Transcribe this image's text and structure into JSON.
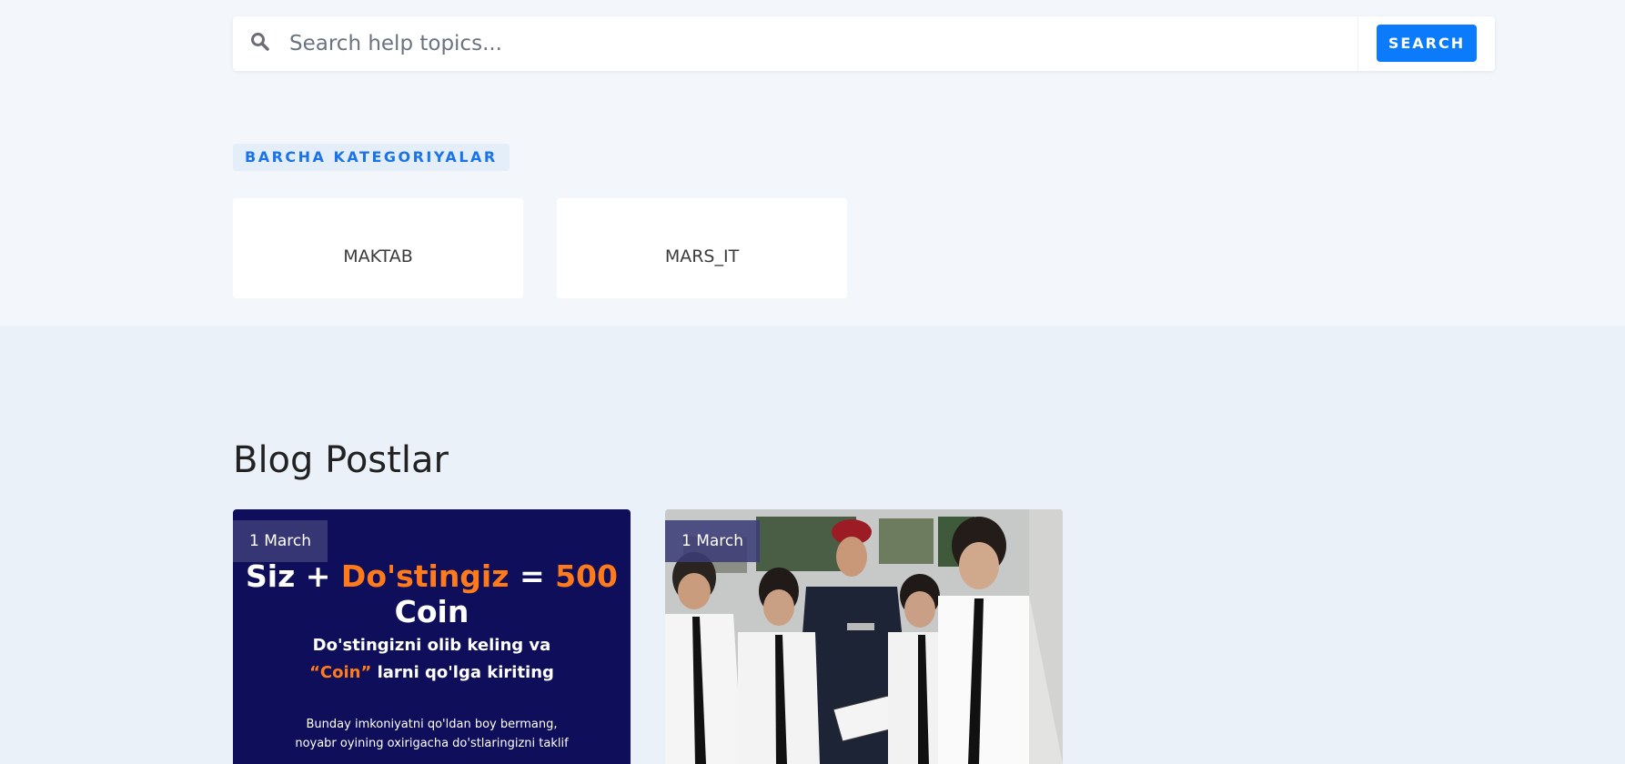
{
  "search": {
    "placeholder": "Search help topics...",
    "button_label": "SEARCH",
    "icon": "search-icon"
  },
  "categories": {
    "heading": "BARCHA KATEGORIYALAR",
    "items": [
      {
        "label": "MAKTAB"
      },
      {
        "label": "MARS_IT"
      }
    ]
  },
  "blog": {
    "title": "Blog Postlar",
    "posts": [
      {
        "date": "1 March",
        "promo": {
          "headline_1": "Siz + ",
          "headline_2": "Do'stingiz",
          "headline_3": " = ",
          "headline_4": "500",
          "headline_5": " Coin",
          "sub_1": "Do'stingizni olib keling va",
          "sub_2": "“Coin”",
          "sub_3": " larni qo'lga kiriting",
          "small_1": "Bunday imkoniyatni qo'ldan boy bermang,",
          "small_2": "noyabr oyining oxirigacha do'stlaringizni taklif"
        }
      },
      {
        "date": "1 March",
        "photo_description": "students in white shirts and ties with a uniformed officer reading a booklet"
      }
    ]
  },
  "colors": {
    "accent": "#0b7bfb",
    "promo_bg": "#0e0e5a",
    "promo_orange": "#ff7a1a"
  }
}
